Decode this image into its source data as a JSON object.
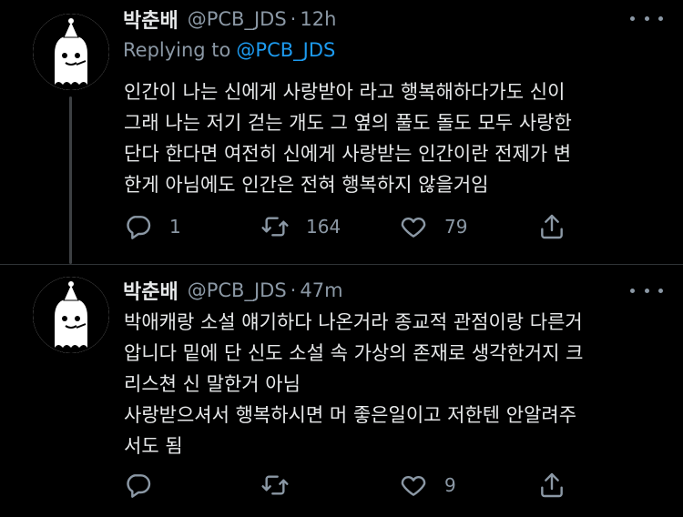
{
  "tweets": [
    {
      "display_name": "박춘배",
      "handle": "@PCB_JDS",
      "separator": "·",
      "time": "12h",
      "replying_label": "Replying to",
      "replying_handle": "@PCB_JDS",
      "lines": [
        "인간이 나는 신에게 사랑받아 라고 행복해하다가도 신이",
        "그래 나는 저기 걷는 개도 그 옆의 풀도 돌도 모두 사랑한",
        "단다 한다면 여전히 신에게 사랑받는 인간이란 전제가 변",
        "한게 아님에도 인간은 전혀 행복하지 않을거임"
      ],
      "reply_count": "1",
      "retweet_count": "164",
      "like_count": "79"
    },
    {
      "display_name": "박춘배",
      "handle": "@PCB_JDS",
      "separator": "·",
      "time": "47m",
      "lines": [
        "박애캐랑 소설 얘기하다 나온거라 종교적 관점이랑 다른거",
        "압니다 밑에 단 신도 소설 속 가상의 존재로 생각한거지 크",
        "리스쳔 신 말한거 아님",
        "사랑받으셔서 행복하시면 머 좋은일이고 저한텐 안알려주",
        "서도 됨"
      ],
      "reply_count": "",
      "retweet_count": "",
      "like_count": "9"
    }
  ],
  "icons": {
    "reply": "reply-icon",
    "retweet": "retweet-icon",
    "like": "heart-icon",
    "share": "share-icon",
    "more": "more-icon"
  },
  "colors": {
    "background": "#000000",
    "text": "#e7e9ea",
    "secondary": "#8b98a5",
    "link": "#1d9bf0"
  }
}
